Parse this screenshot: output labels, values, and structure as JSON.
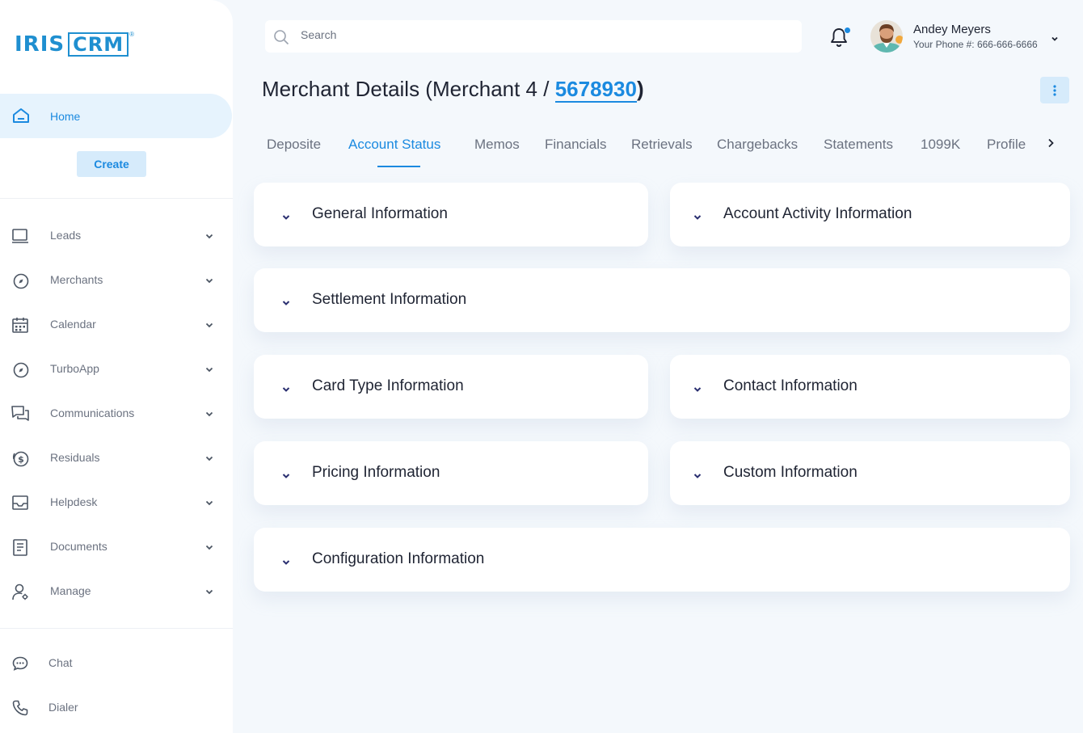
{
  "brand": {
    "logo_left": "IRIS",
    "logo_right": "CRM",
    "logo_mark": "®"
  },
  "sidebar": {
    "home": {
      "label": "Home",
      "icon": "home-icon"
    },
    "create_label": "Create",
    "items": [
      {
        "label": "Leads",
        "icon": "monitor-icon"
      },
      {
        "label": "Merchants",
        "icon": "compass-icon"
      },
      {
        "label": "Calendar",
        "icon": "calendar-icon"
      },
      {
        "label": "TurboApp",
        "icon": "compass-icon"
      },
      {
        "label": "Communications",
        "icon": "chat-bubbles-icon"
      },
      {
        "label": "Residuals",
        "icon": "dollar-circle-icon"
      },
      {
        "label": "Helpdesk",
        "icon": "inbox-icon"
      },
      {
        "label": "Documents",
        "icon": "document-icon"
      },
      {
        "label": "Manage",
        "icon": "user-gear-icon"
      }
    ],
    "bottom": [
      {
        "label": "Chat",
        "icon": "chat-icon"
      },
      {
        "label": "Dialer",
        "icon": "phone-icon"
      }
    ]
  },
  "header": {
    "search_placeholder": "Search",
    "user": {
      "name": "Andey Meyers",
      "phone": "Your Phone #: 666-666-6666"
    }
  },
  "page": {
    "title_prefix": "Merchant Details (Merchant 4 / ",
    "merchant_id": "5678930",
    "title_suffix": ")"
  },
  "tabs": [
    {
      "label": "Deposite"
    },
    {
      "label": "Account Status",
      "active": true
    },
    {
      "label": "Memos"
    },
    {
      "label": "Financials"
    },
    {
      "label": "Retrievals"
    },
    {
      "label": "Chargebacks"
    },
    {
      "label": "Statements"
    },
    {
      "label": "1099K"
    },
    {
      "label": "Profile"
    }
  ],
  "sections": [
    {
      "title": "General Information"
    },
    {
      "title": "Account Activity Information"
    },
    {
      "title": "Settlement Information"
    },
    {
      "title": "Card Type Information"
    },
    {
      "title": "Contact Information"
    },
    {
      "title": "Pricing Information"
    },
    {
      "title": "Custom Information"
    },
    {
      "title": "Configuration Information"
    }
  ],
  "colors": {
    "accent": "#1b8ae0",
    "accent_soft": "#e6f3fd",
    "background": "#f4f8fc"
  }
}
